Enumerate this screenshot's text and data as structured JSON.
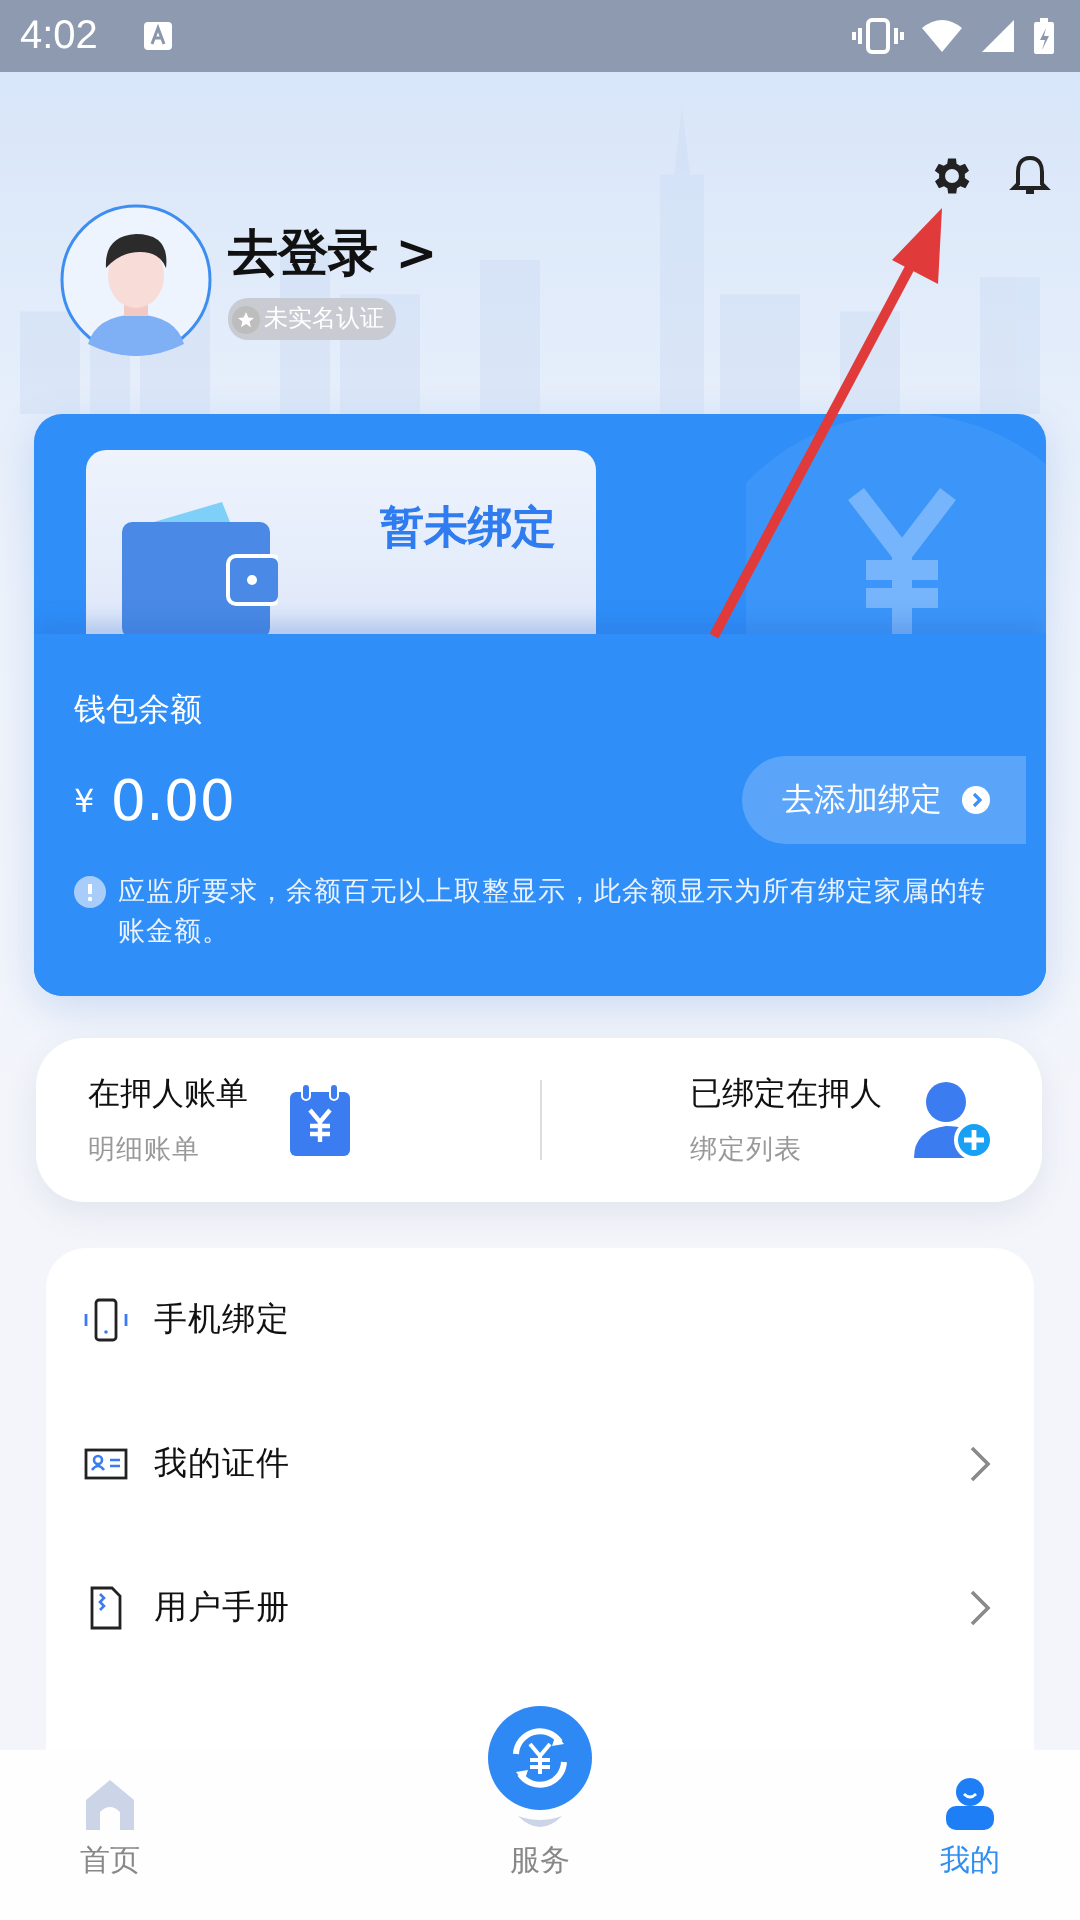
{
  "status_bar": {
    "time": "4:02"
  },
  "profile": {
    "login_label": "去登录 >",
    "verification_badge": "未实名认证"
  },
  "wallet": {
    "bind_status": "暂未绑定",
    "balance_label": "钱包余额",
    "currency": "¥",
    "balance": "0.00",
    "add_button": "去添加绑定",
    "notice": "应监所要求，余额百元以上取整显示，此余额显示为所有绑定家属的转账金额。"
  },
  "shortcuts": [
    {
      "kind": "bill",
      "title": "在押人账单",
      "subtitle": "明细账单"
    },
    {
      "kind": "person",
      "title": "已绑定在押人",
      "subtitle": "绑定列表"
    }
  ],
  "menu": [
    {
      "kind": "phone",
      "label": "手机绑定",
      "has_chevron": false
    },
    {
      "kind": "id",
      "label": "我的证件",
      "has_chevron": true
    },
    {
      "kind": "manual",
      "label": "用户手册",
      "has_chevron": true
    }
  ],
  "bottom_nav": [
    {
      "kind": "home",
      "label": "首页",
      "selected": false
    },
    {
      "kind": "service",
      "label": "服务",
      "selected": false
    },
    {
      "kind": "me",
      "label": "我的",
      "selected": true
    }
  ]
}
